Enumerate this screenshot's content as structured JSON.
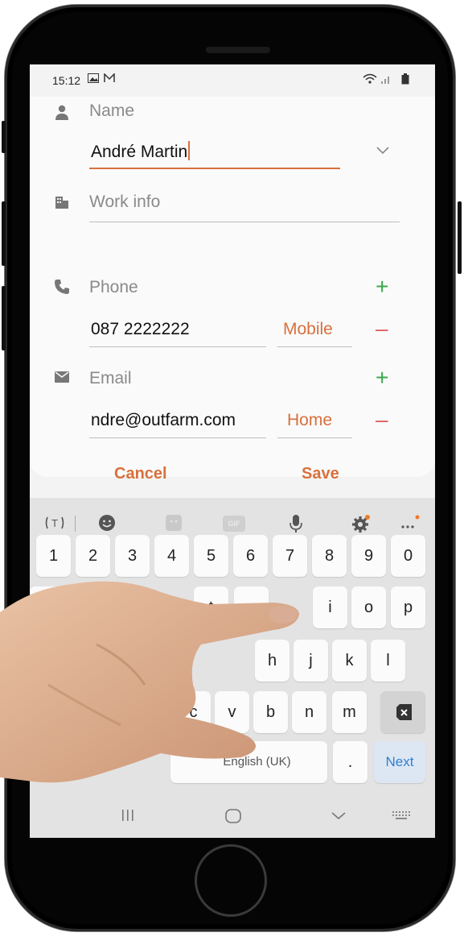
{
  "status": {
    "time": "15:12",
    "left_icons": [
      "image-icon",
      "mail-icon"
    ],
    "right_icons": [
      "wifi-icon",
      "signal-icon",
      "battery-icon"
    ]
  },
  "form": {
    "name": {
      "label": "Name",
      "value": "André Martin"
    },
    "work": {
      "label": "Work info"
    },
    "phone": {
      "label": "Phone",
      "value": "087 2222222",
      "type": "Mobile"
    },
    "email": {
      "label": "Email",
      "value": "ndre@outfarm.com",
      "type": "Home"
    }
  },
  "actions": {
    "cancel": "Cancel",
    "save": "Save"
  },
  "keyboard": {
    "toolbar": [
      "translate-icon",
      "emoji-icon",
      "sticker-icon",
      "gif-icon",
      "mic-icon",
      "gear-icon",
      "more-icon"
    ],
    "gif_label": "GIF",
    "numbers": [
      "1",
      "2",
      "3",
      "4",
      "5",
      "6",
      "7",
      "8",
      "9",
      "0"
    ],
    "row1_visible": [
      "t",
      "y",
      "i",
      "o",
      "p"
    ],
    "row2_visible": [
      "h",
      "j",
      "k",
      "l"
    ],
    "row3_visible": [
      "c",
      "v",
      "b",
      "n",
      "m"
    ],
    "space_label": "English (UK)",
    "period": ".",
    "next": "Next"
  },
  "navbar": [
    "recents-icon",
    "home-icon",
    "back-icon",
    "keyboard-icon"
  ],
  "colors": {
    "accent": "#d8703c",
    "plus": "#3aa94a",
    "minus": "#e06060",
    "next": "#2f7fd0"
  }
}
